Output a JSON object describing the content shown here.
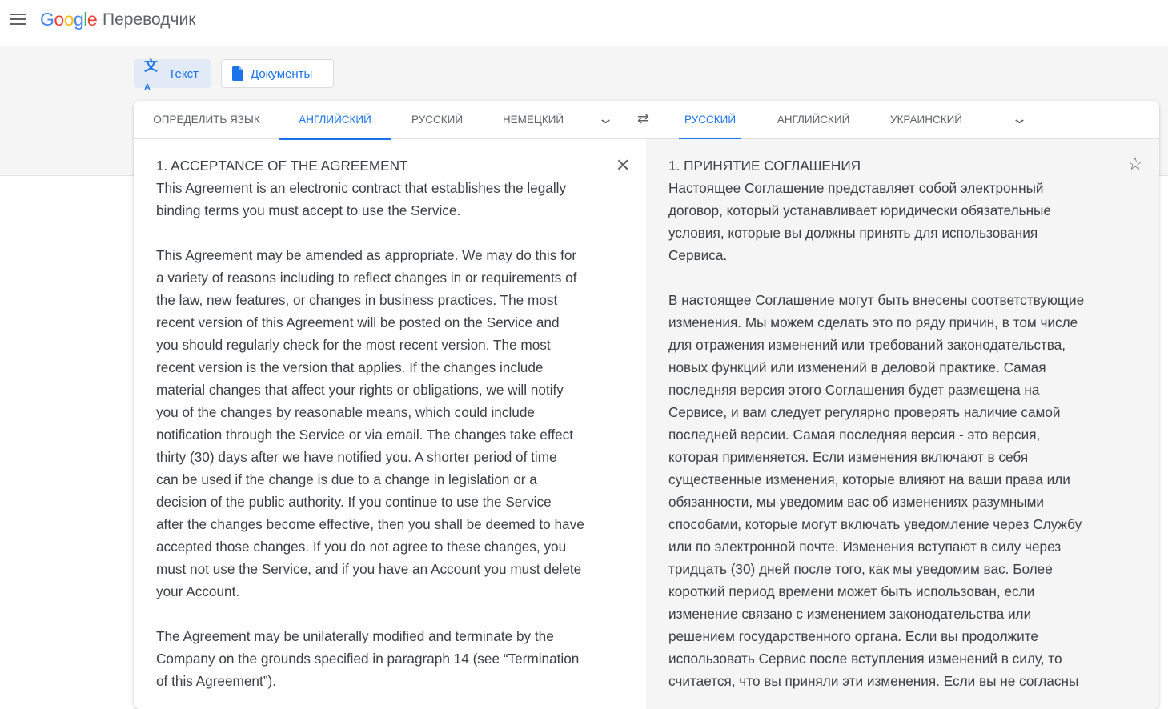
{
  "header": {
    "logo": "Google",
    "app_name": "Переводчик"
  },
  "modes": {
    "text": "Текст",
    "documents": "Документы"
  },
  "source_tabs": [
    "ОПРЕДЕЛИТЬ ЯЗЫК",
    "АНГЛИЙСКИЙ",
    "РУССКИЙ",
    "НЕМЕЦКИЙ"
  ],
  "target_tabs": [
    "РУССКИЙ",
    "АНГЛИЙСКИЙ",
    "УКРАИНСКИЙ"
  ],
  "source_lines": [
    "1. ACCEPTANCE OF THE AGREEMENT",
    "This Agreement is an electronic contract that establishes the legally",
    "binding terms you must accept to use the Service.",
    "",
    "This Agreement may be amended as appropriate. We may do this for",
    "a variety of reasons including to reflect changes in or requirements of",
    "the law, new features, or changes in business practices. The most",
    "recent version of this Agreement will be posted on the Service and",
    "you should regularly check for the most recent version. The most",
    "recent version is the version that applies. If the changes include",
    "material changes that affect your rights or obligations, we will notify",
    "you of the changes by reasonable means, which could include",
    "notification through the Service or via email. The changes take effect",
    "thirty (30) days after we have notified you. A shorter period of time",
    "can be used if the change is due to a change in legislation or a",
    "decision of the public authority. If you continue to use the Service",
    "after the changes become effective, then you shall be deemed to have",
    "accepted those changes. If you do not agree to these changes, you",
    "must not use the Service, and if you have an Account you must delete",
    "your Account.",
    "",
    "The Agreement may be unilaterally modified and terminate by the",
    "Company on the grounds specified in paragraph 14 (see “Termination",
    "of this Agreement”)."
  ],
  "target_lines": [
    "1. ПРИНЯТИЕ СОГЛАШЕНИЯ",
    "Настоящее Соглашение представляет собой электронный",
    "договор, который устанавливает юридически обязательные",
    "условия, которые вы должны принять для использования",
    "Сервиса.",
    "",
    "В настоящее Соглашение могут быть внесены соответствующие",
    "изменения. Мы можем сделать это по ряду причин, в том числе",
    "для отражения изменений или требований законодательства,",
    "новых функций или изменений в деловой практике. Самая",
    "последняя версия этого Соглашения будет размещена на",
    "Сервисе, и вам следует регулярно проверять наличие самой",
    "последней версии. Самая последняя версия - это версия,",
    "которая применяется. Если изменения включают в себя",
    "существенные изменения, которые влияют на ваши права или",
    "обязанности, мы уведомим вас об изменениях разумными",
    "способами, которые могут включать уведомление через Службу",
    "или по электронной почте. Изменения вступают в силу через",
    "тридцать (30) дней после того, как мы уведомим вас. Более",
    "короткий период времени может быть использован, если",
    "изменение связано с изменением законодательства или",
    "решением государственного органа. Если вы продолжите",
    "использовать Сервис после вступления изменений в силу, то",
    "считается, что вы приняли эти изменения. Если вы не согласны"
  ],
  "colors": {
    "accent": "#1a73e8",
    "panel": "#f5f5f5"
  }
}
